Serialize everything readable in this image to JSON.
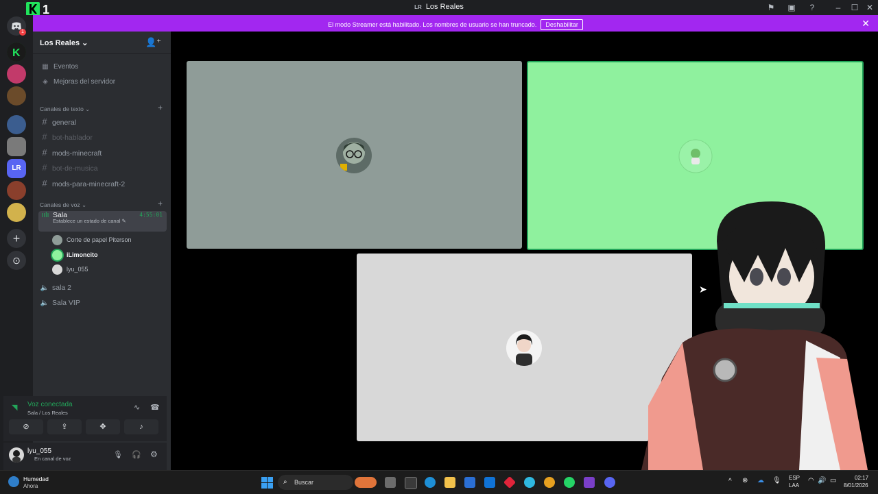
{
  "titlebar": {
    "server_abbr": "LR",
    "window_title": "Los Reales"
  },
  "banner": {
    "message": "El modo Streamer está habilitado. Los nombres de usuario se han truncado.",
    "button": "Deshabilitar"
  },
  "overlay_logo": "K1",
  "sidebar": {
    "server_name": "Los Reales",
    "items": [
      {
        "label": "Eventos",
        "icon": "calendar-icon"
      },
      {
        "label": "Mejoras del servidor",
        "icon": "boost-icon"
      }
    ],
    "text_category": "Canales de texto",
    "text_channels": [
      {
        "label": "general",
        "muted": false
      },
      {
        "label": "bot-hablador",
        "muted": true
      },
      {
        "label": "mods-minecraft",
        "muted": false
      },
      {
        "label": "bot-de-musica",
        "muted": true
      },
      {
        "label": "mods-para-minecraft-2",
        "muted": false
      }
    ],
    "voice_category": "Canales de voz",
    "active_voice": {
      "label": "Sala",
      "status": "Establece un estado de canal",
      "timer": "4:55:01"
    },
    "voice_users": [
      {
        "name": "Corte de papel Piterson"
      },
      {
        "name": "iLimoncito"
      },
      {
        "name": "lyu_055"
      }
    ],
    "voice_channels": [
      {
        "label": "sala 2"
      },
      {
        "label": "Sala VIP"
      }
    ]
  },
  "voice_panel": {
    "status": "Voz conectada",
    "location": "Sala / Los Reales"
  },
  "user_panel": {
    "username": "lyu_055",
    "status": "En canal de voz"
  },
  "tiles": [
    {
      "name": "tile-piterson",
      "color": "#8f9c98"
    },
    {
      "name": "tile-ilimoncito",
      "color": "#8ff19e",
      "border": "#23a55a"
    },
    {
      "name": "tile-lyu",
      "color": "#d8d8d8"
    }
  ],
  "taskbar": {
    "weather_title": "Humedad",
    "weather_sub": "Ahora",
    "search_placeholder": "Buscar",
    "lang": "ESP",
    "lang_sub": "LAA",
    "time": "02:17",
    "date": "8/01/2026"
  },
  "colors": {
    "accent": "#a227f0",
    "online": "#23a55a",
    "rail": "#1e1f22",
    "sidebar": "#2b2d31"
  }
}
